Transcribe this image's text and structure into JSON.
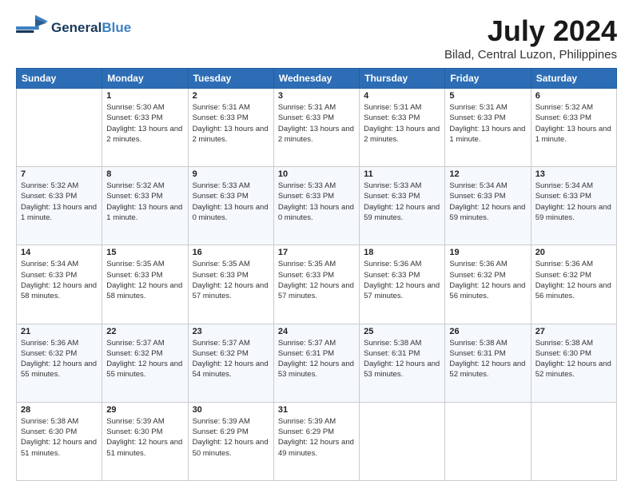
{
  "header": {
    "logo_general": "General",
    "logo_blue": "Blue",
    "title": "July 2024",
    "subtitle": "Bilad, Central Luzon, Philippines"
  },
  "columns": [
    "Sunday",
    "Monday",
    "Tuesday",
    "Wednesday",
    "Thursday",
    "Friday",
    "Saturday"
  ],
  "weeks": [
    [
      {
        "day": "",
        "sunrise": "",
        "sunset": "",
        "daylight": "",
        "empty": true
      },
      {
        "day": "1",
        "sunrise": "Sunrise: 5:30 AM",
        "sunset": "Sunset: 6:33 PM",
        "daylight": "Daylight: 13 hours and 2 minutes."
      },
      {
        "day": "2",
        "sunrise": "Sunrise: 5:31 AM",
        "sunset": "Sunset: 6:33 PM",
        "daylight": "Daylight: 13 hours and 2 minutes."
      },
      {
        "day": "3",
        "sunrise": "Sunrise: 5:31 AM",
        "sunset": "Sunset: 6:33 PM",
        "daylight": "Daylight: 13 hours and 2 minutes."
      },
      {
        "day": "4",
        "sunrise": "Sunrise: 5:31 AM",
        "sunset": "Sunset: 6:33 PM",
        "daylight": "Daylight: 13 hours and 2 minutes."
      },
      {
        "day": "5",
        "sunrise": "Sunrise: 5:31 AM",
        "sunset": "Sunset: 6:33 PM",
        "daylight": "Daylight: 13 hours and 1 minute."
      },
      {
        "day": "6",
        "sunrise": "Sunrise: 5:32 AM",
        "sunset": "Sunset: 6:33 PM",
        "daylight": "Daylight: 13 hours and 1 minute."
      }
    ],
    [
      {
        "day": "7",
        "sunrise": "Sunrise: 5:32 AM",
        "sunset": "Sunset: 6:33 PM",
        "daylight": "Daylight: 13 hours and 1 minute."
      },
      {
        "day": "8",
        "sunrise": "Sunrise: 5:32 AM",
        "sunset": "Sunset: 6:33 PM",
        "daylight": "Daylight: 13 hours and 1 minute."
      },
      {
        "day": "9",
        "sunrise": "Sunrise: 5:33 AM",
        "sunset": "Sunset: 6:33 PM",
        "daylight": "Daylight: 13 hours and 0 minutes."
      },
      {
        "day": "10",
        "sunrise": "Sunrise: 5:33 AM",
        "sunset": "Sunset: 6:33 PM",
        "daylight": "Daylight: 13 hours and 0 minutes."
      },
      {
        "day": "11",
        "sunrise": "Sunrise: 5:33 AM",
        "sunset": "Sunset: 6:33 PM",
        "daylight": "Daylight: 12 hours and 59 minutes."
      },
      {
        "day": "12",
        "sunrise": "Sunrise: 5:34 AM",
        "sunset": "Sunset: 6:33 PM",
        "daylight": "Daylight: 12 hours and 59 minutes."
      },
      {
        "day": "13",
        "sunrise": "Sunrise: 5:34 AM",
        "sunset": "Sunset: 6:33 PM",
        "daylight": "Daylight: 12 hours and 59 minutes."
      }
    ],
    [
      {
        "day": "14",
        "sunrise": "Sunrise: 5:34 AM",
        "sunset": "Sunset: 6:33 PM",
        "daylight": "Daylight: 12 hours and 58 minutes."
      },
      {
        "day": "15",
        "sunrise": "Sunrise: 5:35 AM",
        "sunset": "Sunset: 6:33 PM",
        "daylight": "Daylight: 12 hours and 58 minutes."
      },
      {
        "day": "16",
        "sunrise": "Sunrise: 5:35 AM",
        "sunset": "Sunset: 6:33 PM",
        "daylight": "Daylight: 12 hours and 57 minutes."
      },
      {
        "day": "17",
        "sunrise": "Sunrise: 5:35 AM",
        "sunset": "Sunset: 6:33 PM",
        "daylight": "Daylight: 12 hours and 57 minutes."
      },
      {
        "day": "18",
        "sunrise": "Sunrise: 5:36 AM",
        "sunset": "Sunset: 6:33 PM",
        "daylight": "Daylight: 12 hours and 57 minutes."
      },
      {
        "day": "19",
        "sunrise": "Sunrise: 5:36 AM",
        "sunset": "Sunset: 6:32 PM",
        "daylight": "Daylight: 12 hours and 56 minutes."
      },
      {
        "day": "20",
        "sunrise": "Sunrise: 5:36 AM",
        "sunset": "Sunset: 6:32 PM",
        "daylight": "Daylight: 12 hours and 56 minutes."
      }
    ],
    [
      {
        "day": "21",
        "sunrise": "Sunrise: 5:36 AM",
        "sunset": "Sunset: 6:32 PM",
        "daylight": "Daylight: 12 hours and 55 minutes."
      },
      {
        "day": "22",
        "sunrise": "Sunrise: 5:37 AM",
        "sunset": "Sunset: 6:32 PM",
        "daylight": "Daylight: 12 hours and 55 minutes."
      },
      {
        "day": "23",
        "sunrise": "Sunrise: 5:37 AM",
        "sunset": "Sunset: 6:32 PM",
        "daylight": "Daylight: 12 hours and 54 minutes."
      },
      {
        "day": "24",
        "sunrise": "Sunrise: 5:37 AM",
        "sunset": "Sunset: 6:31 PM",
        "daylight": "Daylight: 12 hours and 53 minutes."
      },
      {
        "day": "25",
        "sunrise": "Sunrise: 5:38 AM",
        "sunset": "Sunset: 6:31 PM",
        "daylight": "Daylight: 12 hours and 53 minutes."
      },
      {
        "day": "26",
        "sunrise": "Sunrise: 5:38 AM",
        "sunset": "Sunset: 6:31 PM",
        "daylight": "Daylight: 12 hours and 52 minutes."
      },
      {
        "day": "27",
        "sunrise": "Sunrise: 5:38 AM",
        "sunset": "Sunset: 6:30 PM",
        "daylight": "Daylight: 12 hours and 52 minutes."
      }
    ],
    [
      {
        "day": "28",
        "sunrise": "Sunrise: 5:38 AM",
        "sunset": "Sunset: 6:30 PM",
        "daylight": "Daylight: 12 hours and 51 minutes."
      },
      {
        "day": "29",
        "sunrise": "Sunrise: 5:39 AM",
        "sunset": "Sunset: 6:30 PM",
        "daylight": "Daylight: 12 hours and 51 minutes."
      },
      {
        "day": "30",
        "sunrise": "Sunrise: 5:39 AM",
        "sunset": "Sunset: 6:29 PM",
        "daylight": "Daylight: 12 hours and 50 minutes."
      },
      {
        "day": "31",
        "sunrise": "Sunrise: 5:39 AM",
        "sunset": "Sunset: 6:29 PM",
        "daylight": "Daylight: 12 hours and 49 minutes."
      },
      {
        "day": "",
        "sunrise": "",
        "sunset": "",
        "daylight": "",
        "empty": true
      },
      {
        "day": "",
        "sunrise": "",
        "sunset": "",
        "daylight": "",
        "empty": true
      },
      {
        "day": "",
        "sunrise": "",
        "sunset": "",
        "daylight": "",
        "empty": true
      }
    ]
  ]
}
